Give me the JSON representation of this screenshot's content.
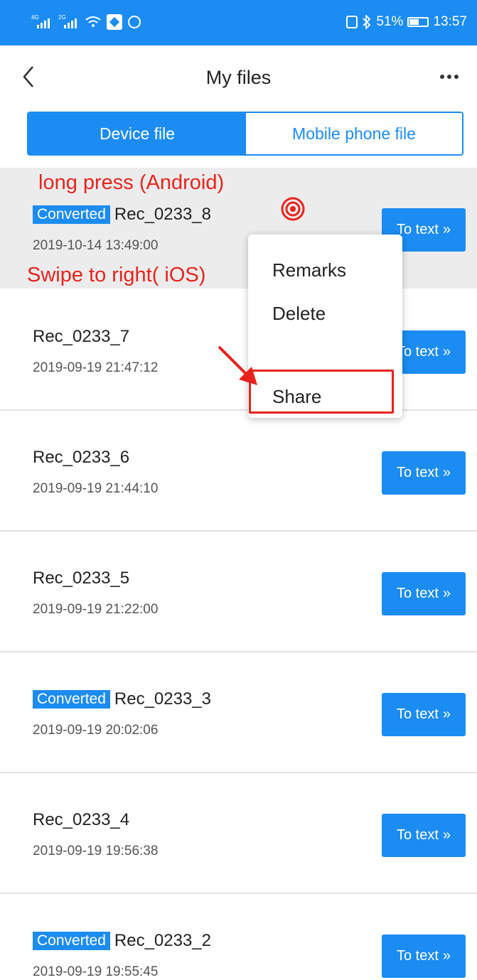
{
  "status_bar": {
    "sim1": "4G",
    "sim2": "2G",
    "battery": "51%",
    "time": "13:57",
    "icons": [
      "signal-icon",
      "signal-icon",
      "wifi-icon",
      "nfc-app-icon",
      "cast-icon",
      "nfc-icon",
      "bluetooth-icon",
      "battery-icon"
    ]
  },
  "header": {
    "title": "My files",
    "back_icon": "chevron-left-icon",
    "more_icon": "more-horizontal-icon"
  },
  "tabs": [
    {
      "label": "Device file",
      "active": true
    },
    {
      "label": "Mobile phone file",
      "active": false
    }
  ],
  "annotations": {
    "long_press": "long press (Android)",
    "swipe": "Swipe to right( iOS)"
  },
  "popup_menu": {
    "items": [
      "Remarks",
      "Delete",
      "Share"
    ]
  },
  "files": [
    {
      "name": "Rec_0233_8",
      "date": "2019-10-14 13:49:00",
      "badge": "Converted",
      "button": "To text"
    },
    {
      "name": "Rec_0233_7",
      "date": "2019-09-19 21:47:12",
      "badge": "",
      "button": "To text"
    },
    {
      "name": "Rec_0233_6",
      "date": "2019-09-19 21:44:10",
      "badge": "",
      "button": "To text"
    },
    {
      "name": "Rec_0233_5",
      "date": "2019-09-19 21:22:00",
      "badge": "",
      "button": "To text"
    },
    {
      "name": "Rec_0233_3",
      "date": "2019-09-19 20:02:06",
      "badge": "Converted",
      "button": "To text"
    },
    {
      "name": "Rec_0233_4",
      "date": "2019-09-19 19:56:38",
      "badge": "",
      "button": "To text"
    },
    {
      "name": "Rec_0233_2",
      "date": "2019-09-19 19:55:45",
      "badge": "Converted",
      "button": "To text"
    }
  ],
  "colors": {
    "accent": "#1b8cf2",
    "annotation": "#e8231d",
    "highlight_row": "#ececec"
  }
}
